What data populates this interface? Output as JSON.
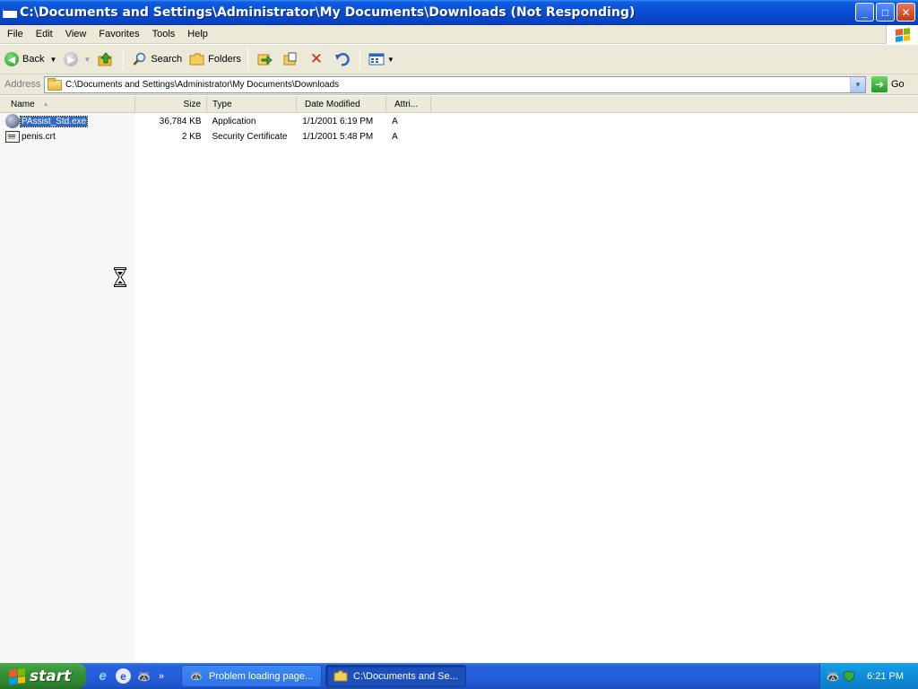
{
  "window": {
    "title": "C:\\Documents and Settings\\Administrator\\My Documents\\Downloads (Not Responding)",
    "controls": {
      "minimize": "_",
      "maximize": "□",
      "close": "✕"
    }
  },
  "menu": {
    "items": [
      "File",
      "Edit",
      "View",
      "Favorites",
      "Tools",
      "Help"
    ]
  },
  "toolbar": {
    "back_label": "Back",
    "search_label": "Search",
    "folders_label": "Folders",
    "icons": [
      "back-icon",
      "forward-icon",
      "up-folder-icon",
      "search-icon",
      "folders-icon",
      "move-to-icon",
      "copy-to-icon",
      "delete-icon",
      "undo-icon",
      "views-icon"
    ]
  },
  "address": {
    "label": "Address",
    "value": "C:\\Documents and Settings\\Administrator\\My Documents\\Downloads",
    "go_label": "Go"
  },
  "list": {
    "columns": [
      "Name",
      "Size",
      "Type",
      "Date Modified",
      "Attri..."
    ],
    "rows": [
      {
        "name": "PAssist_Std.exe",
        "size": "36,784 KB",
        "type": "Application",
        "date": "1/1/2001 6:19 PM",
        "attr": "A",
        "selected": true,
        "icon": "exe-icon"
      },
      {
        "name": "penis.crt",
        "size": "2 KB",
        "type": "Security Certificate",
        "date": "1/1/2001 5:48 PM",
        "attr": "A",
        "selected": false,
        "icon": "certificate-icon"
      }
    ]
  },
  "taskbar": {
    "start_label": "start",
    "quick_launch_more": "»",
    "tasks": [
      {
        "label": "Problem loading page...",
        "active": false
      },
      {
        "label": "C:\\Documents and Se...",
        "active": true
      }
    ],
    "clock": "6:21 PM"
  },
  "colors": {
    "titlebar": "#0a4fd4",
    "selection": "#316ac5",
    "chrome": "#ece9d8",
    "taskbar": "#245edb",
    "start_button": "#358f35",
    "tray": "#0f8bd8"
  }
}
